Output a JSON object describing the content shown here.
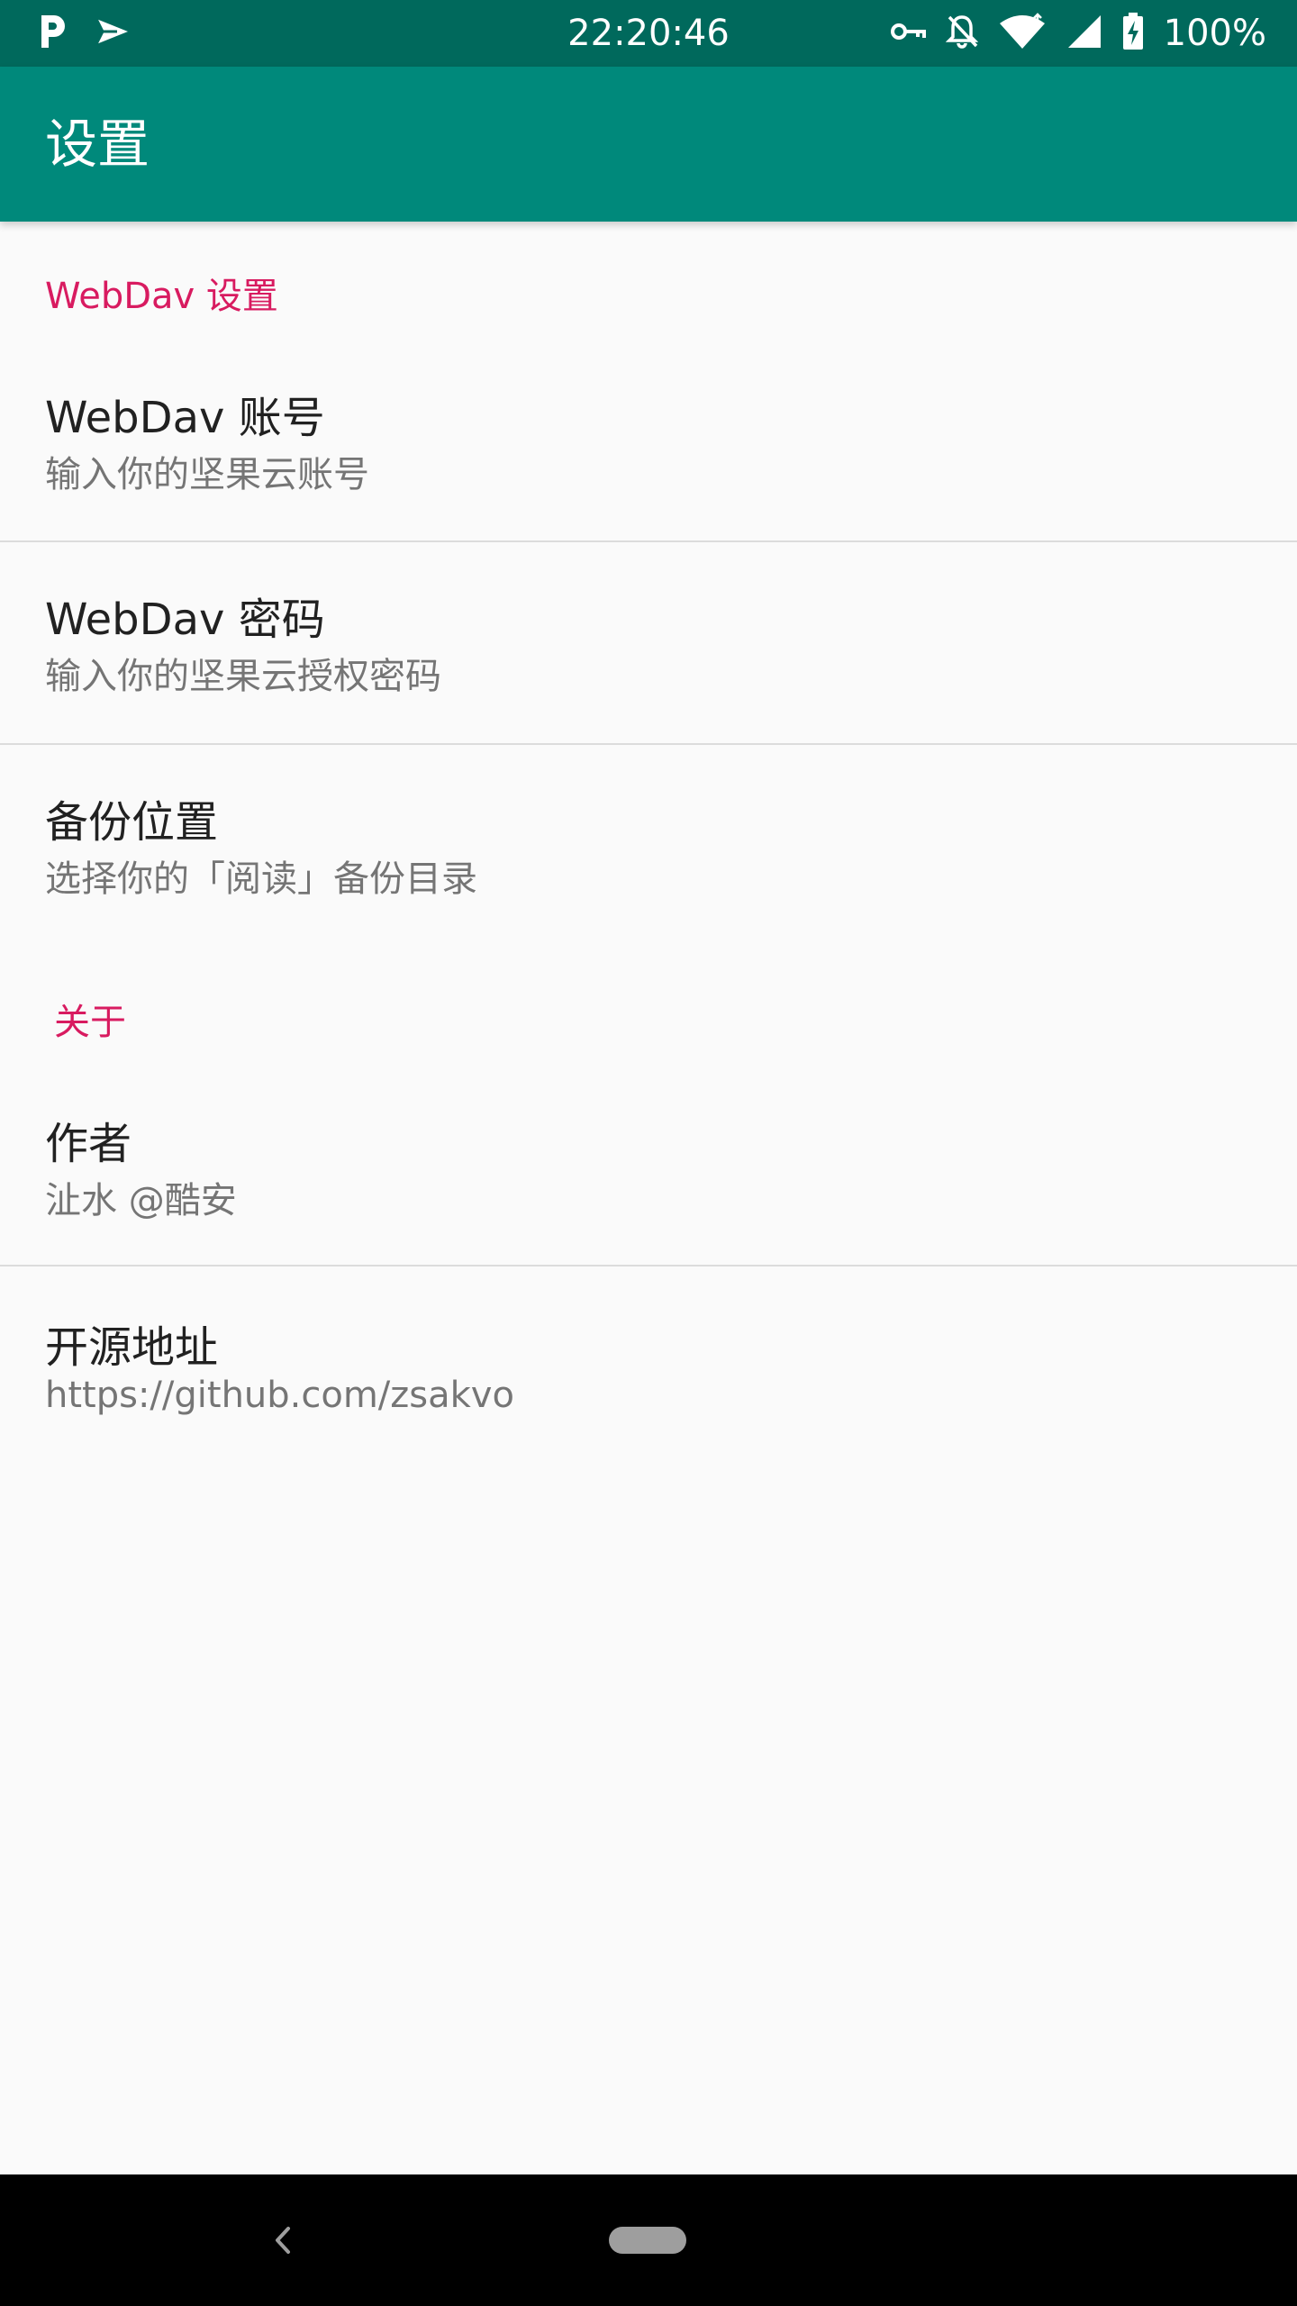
{
  "status_bar": {
    "time": "22:20:46",
    "battery": "100%",
    "icons": [
      "parking-icon",
      "send-icon",
      "vpn-key-icon",
      "notifications-off-icon",
      "wifi-icon",
      "signal-icon",
      "battery-charging-icon"
    ]
  },
  "app_bar": {
    "title": "设置"
  },
  "sections": [
    {
      "category": "WebDav 设置",
      "items": [
        {
          "title": "WebDav 账号",
          "summary": "输入你的坚果云账号"
        },
        {
          "title": "WebDav 密码",
          "summary": "输入你的坚果云授权密码"
        },
        {
          "title": "备份位置",
          "summary": "选择你的「阅读」备份目录"
        }
      ]
    },
    {
      "category": "关于",
      "items": [
        {
          "title": "作者",
          "summary": "沚水 @酷安"
        },
        {
          "title": "开源地址",
          "summary": "https://github.com/zsakvo"
        }
      ]
    }
  ],
  "nav_bar": {
    "icons": [
      "back-icon",
      "home-pill-icon"
    ]
  },
  "colors": {
    "status_bar": "#00695c",
    "app_bar": "#00897b",
    "category": "#d81b60",
    "background": "#fafafa"
  }
}
